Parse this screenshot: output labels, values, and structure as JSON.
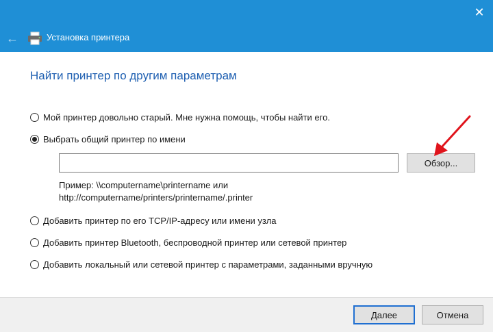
{
  "window": {
    "close_glyph": "✕"
  },
  "nav": {
    "back_glyph": "←",
    "title": "Установка принтера"
  },
  "main": {
    "heading": "Найти принтер по другим параметрам",
    "options": [
      {
        "label": "Мой принтер довольно старый. Мне нужна помощь, чтобы найти его.",
        "checked": false
      },
      {
        "label": "Выбрать общий принтер по имени",
        "checked": true
      },
      {
        "label": "Добавить принтер по его TCP/IP-адресу или имени узла",
        "checked": false
      },
      {
        "label": "Добавить принтер Bluetooth, беспроводной принтер или сетевой принтер",
        "checked": false
      },
      {
        "label": "Добавить локальный или сетевой принтер с параметрами, заданными вручную",
        "checked": false
      }
    ],
    "printer_name": {
      "value": "",
      "placeholder": ""
    },
    "browse_label": "Обзор...",
    "example_line1": "Пример: \\\\computername\\printername или",
    "example_line2": "http://computername/printers/printername/.printer"
  },
  "footer": {
    "next_label": "Далее",
    "cancel_label": "Отмена"
  },
  "colors": {
    "header_bg": "#1f8fd6",
    "heading": "#1e5fb1",
    "annotation_arrow": "#e0141c"
  }
}
